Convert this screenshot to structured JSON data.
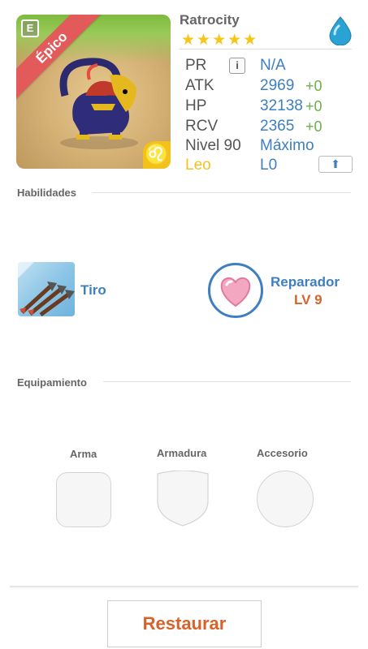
{
  "monster": {
    "name": "Ratrocity",
    "rarity": "Épico",
    "element_badge": "E",
    "stars": "★★★★★",
    "zodiac_symbol": "♌"
  },
  "stats": {
    "pr": {
      "label": "PR",
      "value": "N/A",
      "info_icon": "i"
    },
    "atk": {
      "label": "ATK",
      "value": "2969",
      "delta": "+0"
    },
    "hp": {
      "label": "HP",
      "value": "32138",
      "delta": "+0"
    },
    "rcv": {
      "label": "RCV",
      "value": "2365",
      "delta": "+0"
    },
    "level": {
      "label": "Nivel 90",
      "value": "Máximo"
    },
    "sign": {
      "label": "Leo",
      "value": "L0",
      "upgrade_icon": "⬆"
    }
  },
  "abilities": {
    "title": "Habilidades",
    "active": {
      "name": "Tiro"
    },
    "leader": {
      "name": "Reparador",
      "level": "LV 9"
    }
  },
  "equipment": {
    "title": "Equipamiento",
    "slots": [
      "Arma",
      "Armadura",
      "Accesorio"
    ]
  },
  "actions": {
    "restore_label": "Restaurar"
  },
  "colors": {
    "accent_blue": "#3d7fc1",
    "orange": "#d9622b",
    "green_delta": "#6ab04c",
    "star": "#f5c518",
    "epic_ribbon": "#e35a5a",
    "leo_gold": "#f2c21b"
  }
}
